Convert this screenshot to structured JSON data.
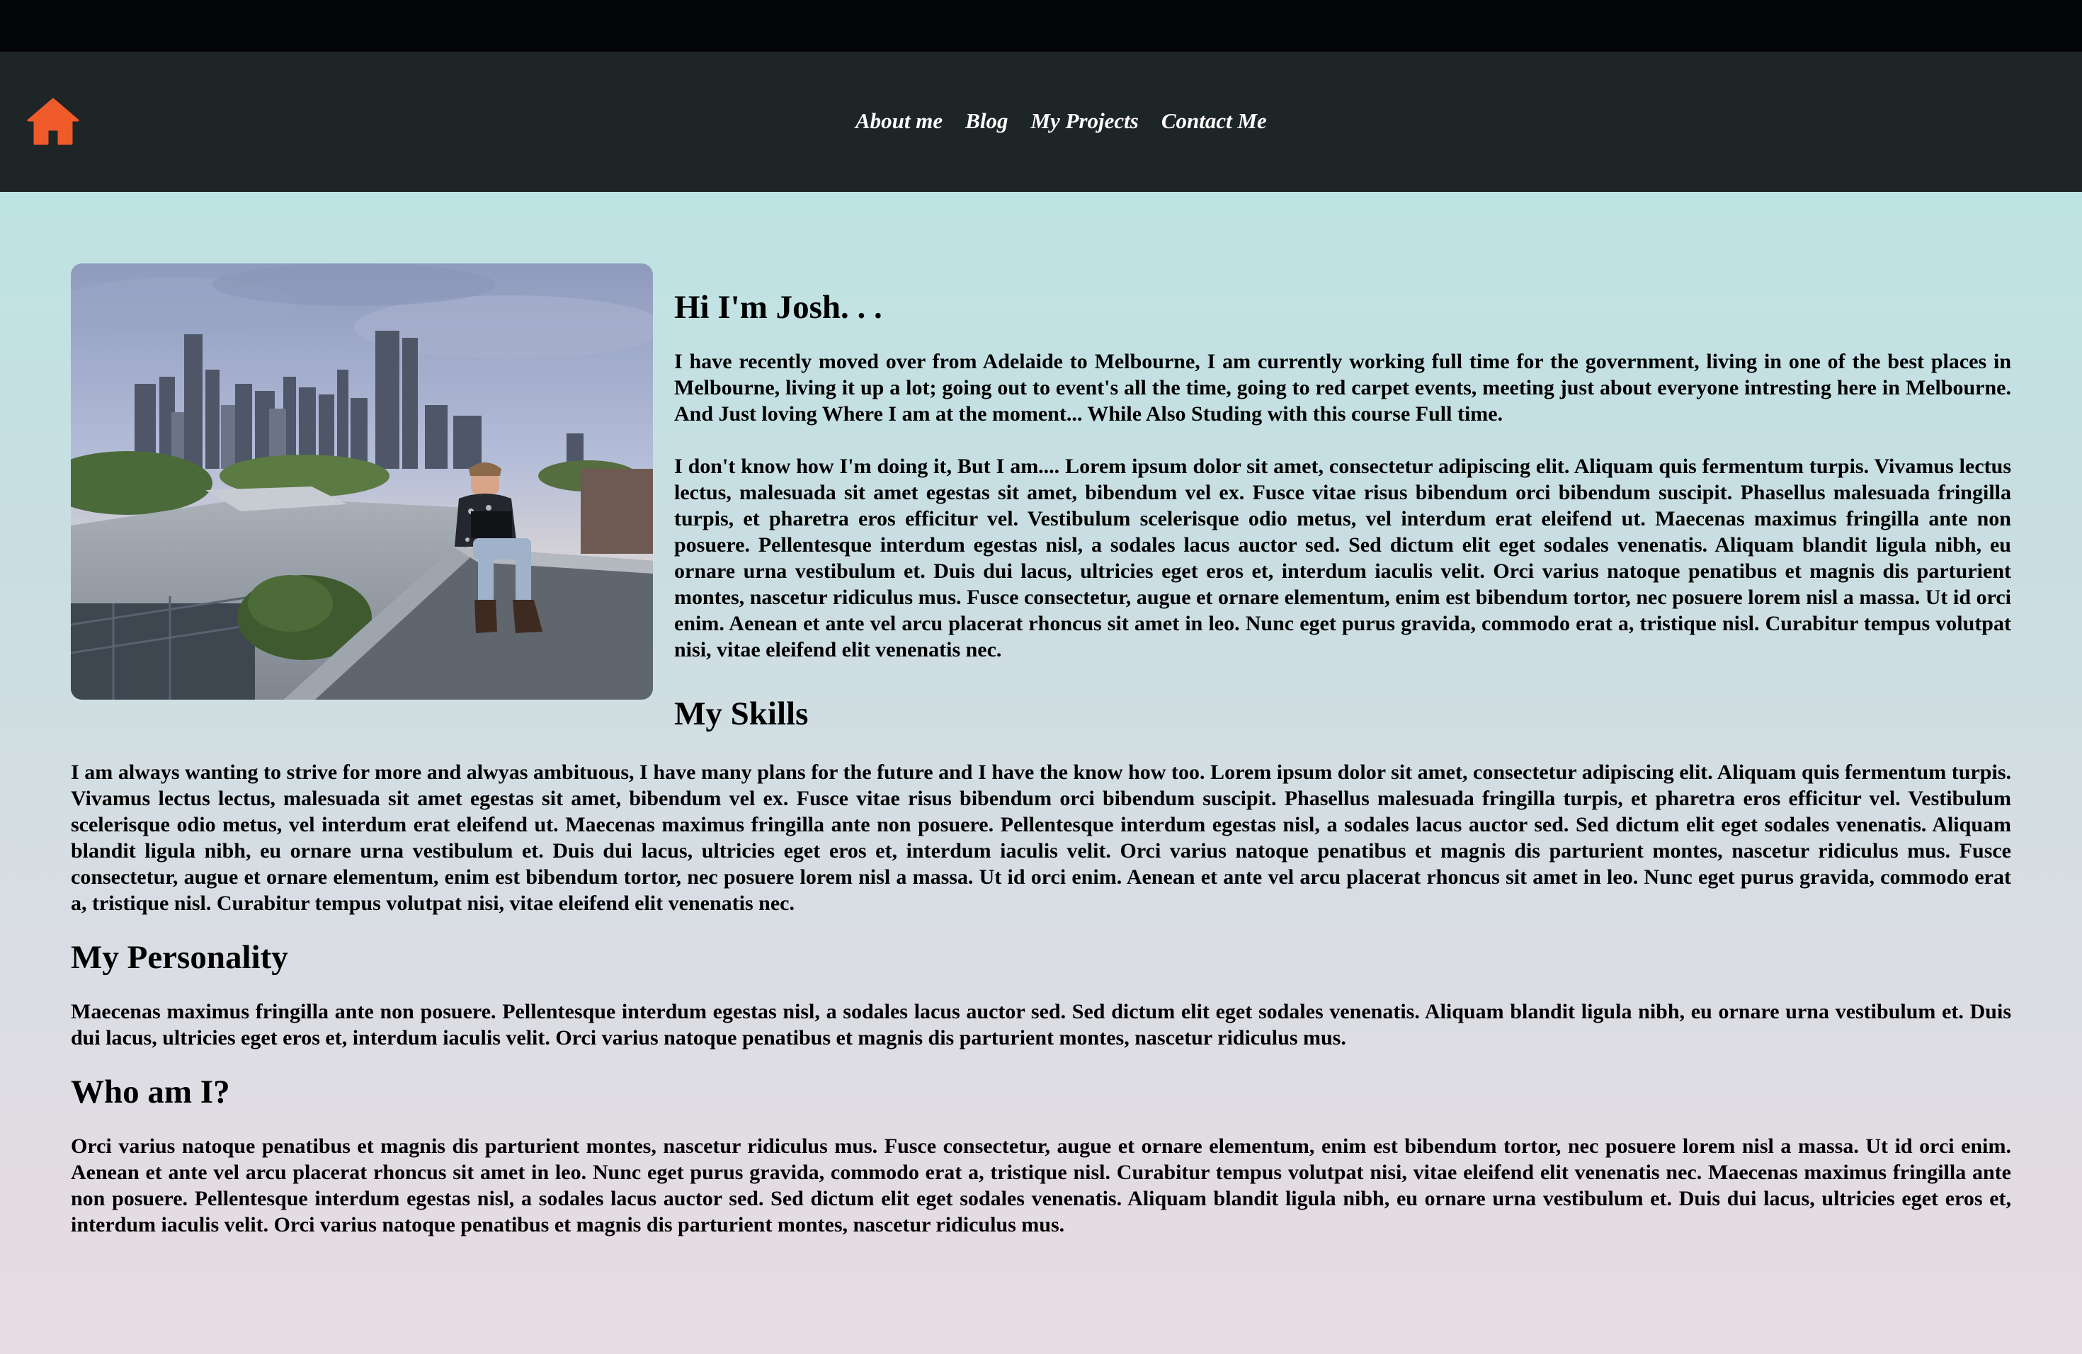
{
  "nav": {
    "home_icon": "home-icon",
    "links": [
      "About me",
      "Blog",
      "My Projects",
      "Contact Me"
    ],
    "accent_color": "#ee5a2a"
  },
  "intro": {
    "greeting": "Hi I'm Josh. . .",
    "paragraph1": "I have recently moved over from Adelaide to Melbourne, I am currently working full time for the government, living in one of the best places in Melbourne, living it up a lot; going out to event's all the time, going to red carpet events, meeting just about everyone intresting here in Melbourne. And Just loving Where I am at the moment... While Also Studing with this course Full time.",
    "paragraph2": "I don't know how I'm doing it, But I am.... Lorem ipsum dolor sit amet, consectetur adipiscing elit. Aliquam quis fermentum turpis. Vivamus lectus lectus, malesuada sit amet egestas sit amet, bibendum vel ex. Fusce vitae risus bibendum orci bibendum suscipit. Phasellus malesuada fringilla turpis, et pharetra eros efficitur vel. Vestibulum scelerisque odio metus, vel interdum erat eleifend ut. Maecenas maximus fringilla ante non posuere. Pellentesque interdum egestas nisl, a sodales lacus auctor sed. Sed dictum elit eget sodales venenatis. Aliquam blandit ligula nibh, eu ornare urna vestibulum et. Duis dui lacus, ultricies eget eros et, interdum iaculis velit. Orci varius natoque penatibus et magnis dis parturient montes, nascetur ridiculus mus. Fusce consectetur, augue et ornare elementum, enim est bibendum tortor, nec posuere lorem nisl a massa. Ut id orci enim. Aenean et ante vel arcu placerat rhoncus sit amet in leo. Nunc eget purus gravida, commodo erat a, tristique nisl. Curabitur tempus volutpat nisi, vitae eleifend elit venenatis nec."
  },
  "skills": {
    "title": "My Skills",
    "text": "I am always wanting to strive for more and alwyas ambituous, I have many plans for the future and I have the know how too. Lorem ipsum dolor sit amet, consectetur adipiscing elit. Aliquam quis fermentum turpis. Vivamus lectus lectus, malesuada sit amet egestas sit amet, bibendum vel ex. Fusce vitae risus bibendum orci bibendum suscipit. Phasellus malesuada fringilla turpis, et pharetra eros efficitur vel. Vestibulum scelerisque odio metus, vel interdum erat eleifend ut. Maecenas maximus fringilla ante non posuere. Pellentesque interdum egestas nisl, a sodales lacus auctor sed. Sed dictum elit eget sodales venenatis. Aliquam blandit ligula nibh, eu ornare urna vestibulum et. Duis dui lacus, ultricies eget eros et, interdum iaculis velit. Orci varius natoque penatibus et magnis dis parturient montes, nascetur ridiculus mus. Fusce consectetur, augue et ornare elementum, enim est bibendum tortor, nec posuere lorem nisl a massa. Ut id orci enim. Aenean et ante vel arcu placerat rhoncus sit amet in leo. Nunc eget purus gravida, commodo erat a, tristique nisl. Curabitur tempus volutpat nisi, vitae eleifend elit venenatis nec."
  },
  "personality": {
    "title": "My Personality",
    "text": "Maecenas maximus fringilla ante non posuere. Pellentesque interdum egestas nisl, a sodales lacus auctor sed. Sed dictum elit eget sodales venenatis. Aliquam blandit ligula nibh, eu ornare urna vestibulum et. Duis dui lacus, ultricies eget eros et, interdum iaculis velit. Orci varius natoque penatibus et magnis dis parturient montes, nascetur ridiculus mus."
  },
  "who": {
    "title": "Who am I?",
    "text": "Orci varius natoque penatibus et magnis dis parturient montes, nascetur ridiculus mus. Fusce consectetur, augue et ornare elementum, enim est bibendum tortor, nec posuere lorem nisl a massa. Ut id orci enim. Aenean et ante vel arcu placerat rhoncus sit amet in leo. Nunc eget purus gravida, commodo erat a, tristique nisl. Curabitur tempus volutpat nisi, vitae eleifend elit venenatis nec. Maecenas maximus fringilla ante non posuere. Pellentesque interdum egestas nisl, a sodales lacus auctor sed. Sed dictum elit eget sodales venenatis. Aliquam blandit ligula nibh, eu ornare urna vestibulum et. Duis dui lacus, ultricies eget eros et, interdum iaculis velit. Orci varius natoque penatibus et magnis dis parturient montes, nascetur ridiculus mus."
  }
}
